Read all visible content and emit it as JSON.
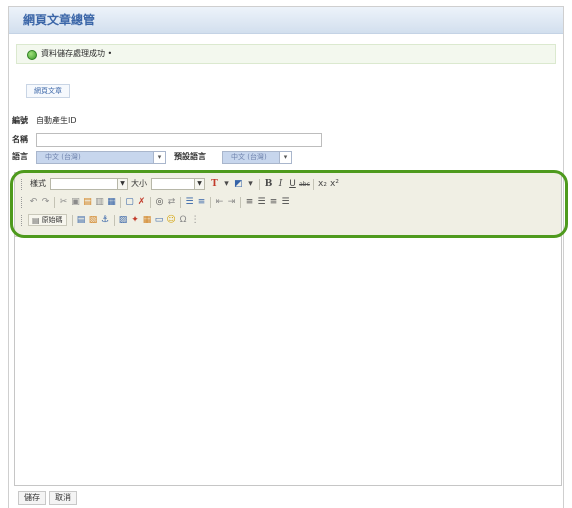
{
  "page": {
    "title": "網頁文章總管"
  },
  "message": {
    "text": "資料儲存處理成功 •",
    "icon": "success-circle-icon"
  },
  "tabs": [
    {
      "label": "網頁文章"
    }
  ],
  "form": {
    "id_label": "編號",
    "id_value": "自動產生ID",
    "name_label": "名稱",
    "lang_label": "語言",
    "lang_value": "中文 (台灣)",
    "default_lang_label": "預設語言",
    "default_lang_value": "中文 (台灣)"
  },
  "editor": {
    "style_label": "樣式",
    "size_label": "大小",
    "source_label": "原始碼",
    "row1_icons": [
      "text-color-icon",
      "chevron-down-icon",
      "bg-color-icon",
      "chevron-down-icon",
      "separator",
      "bold-icon",
      "italic-icon",
      "underline-icon",
      "strikethrough-icon",
      "separator",
      "subscript-icon",
      "superscript-icon"
    ],
    "row2_icons": [
      "undo-icon",
      "redo-icon",
      "separator",
      "cut-icon",
      "copy-icon",
      "paste-icon",
      "paste-text-icon",
      "paste-word-icon",
      "separator",
      "select-all-icon",
      "remove-format-icon",
      "separator",
      "find-icon",
      "replace-icon",
      "separator",
      "ordered-list-icon",
      "unordered-list-icon",
      "separator",
      "outdent-icon",
      "indent-icon",
      "separator",
      "align-left-icon",
      "align-center-icon",
      "align-right-icon",
      "align-justify-icon"
    ],
    "row3_icons": [
      "separator",
      "template-icon",
      "save-template-icon",
      "anchor-icon",
      "separator",
      "image-icon",
      "flash-icon",
      "table-icon",
      "horizontal-rule-icon",
      "smiley-icon",
      "special-char-icon",
      "page-break-icon"
    ]
  },
  "actions": {
    "save_label": "儲存",
    "cancel_label": "取消"
  },
  "colors": {
    "header_text": "#3b66a8",
    "success": "#3a9a2a",
    "highlight": "#4e9a1d"
  }
}
